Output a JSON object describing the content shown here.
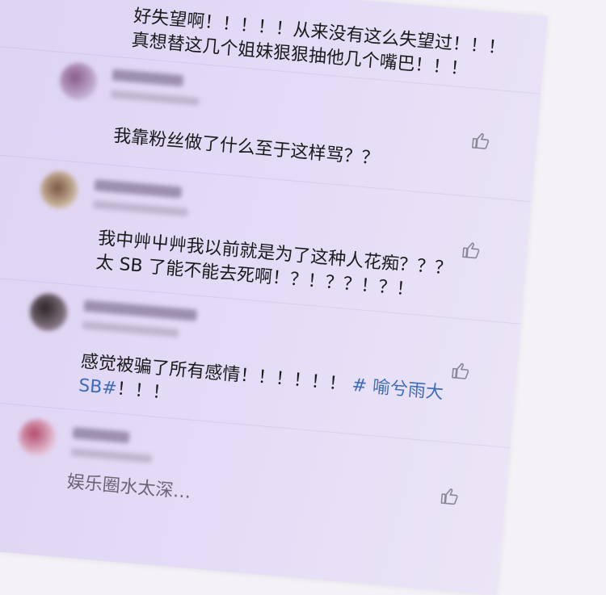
{
  "comments": [
    {
      "lines": [
        "好失望啊！！！！！从来没有这么失望过！！！",
        "真想替这几个姐妹狠狠抽他几个嘴巴！！！"
      ]
    },
    {
      "lines": [
        "我靠粉丝做了什么至于这样骂？？"
      ]
    },
    {
      "lines": [
        "我中艸屮艸我以前就是为了这种人花痴？？？",
        "太 SB 了能不能去死啊！？！？？！？！"
      ]
    },
    {
      "text": "感觉被骗了所有感情！！！！！！",
      "tag": "# 喻兮雨大",
      "line2_tag": "SB#",
      "line2_text": "！！！"
    },
    {
      "lines": [
        "娱乐圈水太深…"
      ]
    }
  ],
  "icons": {
    "like": "thumbs-up-icon"
  }
}
